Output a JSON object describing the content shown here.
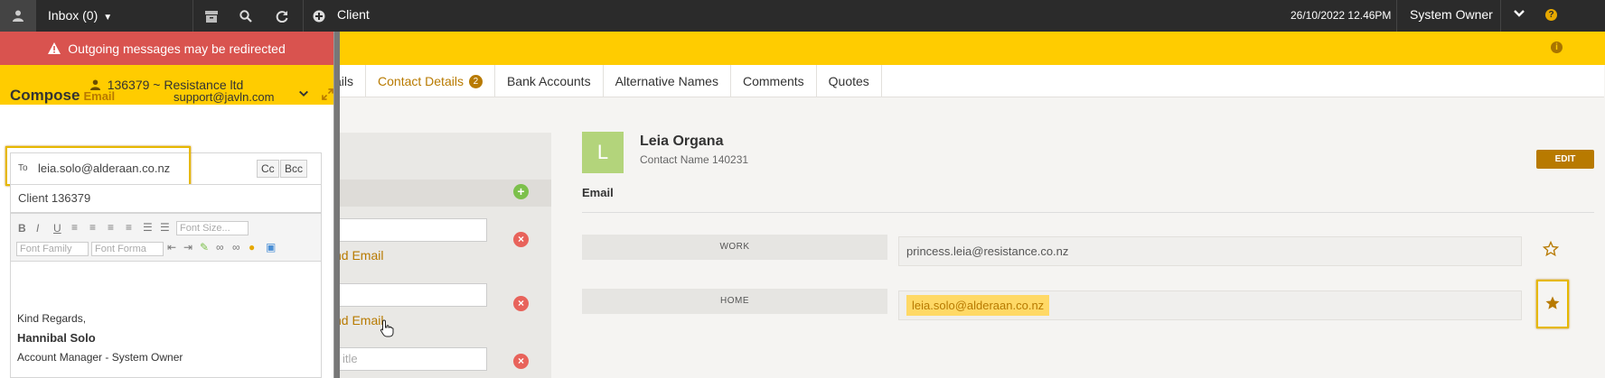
{
  "topbar": {
    "inbox_label": "Inbox (0)",
    "client_label": "Client",
    "datetime": "26/10/2022 12.46PM",
    "user": "System Owner"
  },
  "tabs": [
    {
      "label": "ails"
    },
    {
      "label": "Contact Details",
      "badge": "2"
    },
    {
      "label": "Bank Accounts"
    },
    {
      "label": "Alternative Names"
    },
    {
      "label": "Comments"
    },
    {
      "label": "Quotes"
    }
  ],
  "left_panel": {
    "input3_placeholder": "itle",
    "link1": "nd Email",
    "link2": "nd Email"
  },
  "contact": {
    "avatar_letter": "L",
    "name": "Leia Organa",
    "subtitle": "Contact Name 140231",
    "edit_label": "EDIT",
    "section_label": "Email",
    "emails": [
      {
        "type": "WORK",
        "address": "princess.leia@resistance.co.nz",
        "primary": false
      },
      {
        "type": "HOME",
        "address": "leia.solo@alderaan.co.nz",
        "primary": true
      }
    ]
  },
  "compose": {
    "warning": "Outgoing messages may be redirected",
    "client_strip": "136379 ~ Resistance ltd",
    "title": "Compose",
    "title_sub": "Email",
    "from": "support@javln.com",
    "to_label": "To",
    "to_value": "leia.solo@alderaan.co.nz",
    "cc_label": "Cc",
    "bcc_label": "Bcc",
    "subject": "Client 136379",
    "toolbar": {
      "font_size": "Font Size...",
      "font_family": "Font Family",
      "font_format": "Font Forma"
    },
    "signature": {
      "line1": "Kind Regards,",
      "line2": "Hannibal Solo",
      "line3": "Account Manager - System Owner"
    }
  },
  "colors": {
    "accent": "#b87a00",
    "banner_yellow": "#ffcc00",
    "warning_red": "#d9534f",
    "topbar": "#2b2b2b"
  }
}
